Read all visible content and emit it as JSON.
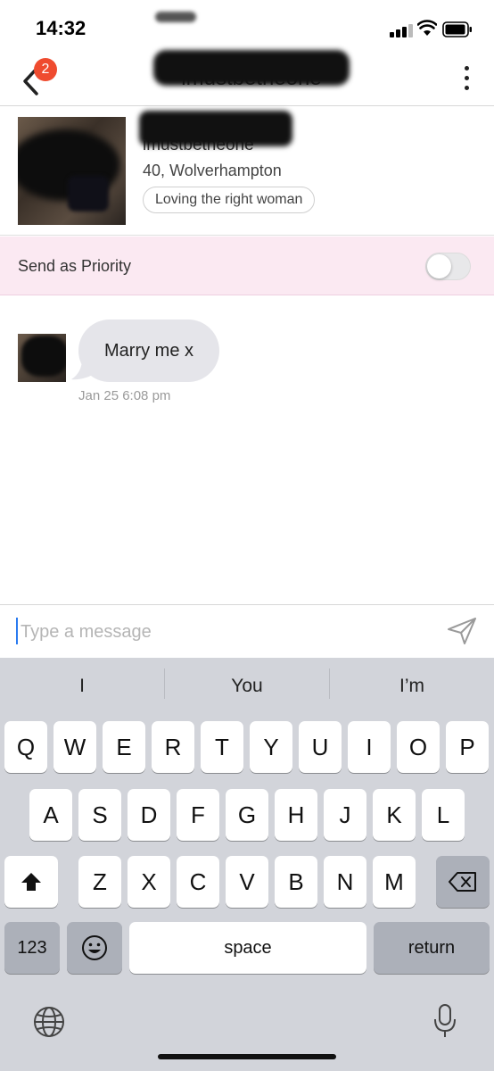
{
  "status": {
    "time": "14:32"
  },
  "header": {
    "back_badge": "2",
    "title": "imustbetheone",
    "back_icon": "chevron-left-icon",
    "more_icon": "vertical-dots-icon"
  },
  "profile": {
    "name": "imustbetheone",
    "location": "40, Wolverhampton",
    "tag": "Loving the right woman"
  },
  "priority": {
    "label": "Send as Priority",
    "enabled": false
  },
  "messages": [
    {
      "text": "Marry me x",
      "time": "Jan 25 6:08 pm"
    }
  ],
  "composer": {
    "placeholder": "Type a message",
    "send_icon": "send-icon"
  },
  "keyboard": {
    "suggestions": [
      "I",
      "You",
      "I’m"
    ],
    "row1": [
      "Q",
      "W",
      "E",
      "R",
      "T",
      "Y",
      "U",
      "I",
      "O",
      "P"
    ],
    "row2": [
      "A",
      "S",
      "D",
      "F",
      "G",
      "H",
      "J",
      "K",
      "L"
    ],
    "row3": [
      "Z",
      "X",
      "C",
      "V",
      "B",
      "N",
      "M"
    ],
    "numbers_label": "123",
    "space_label": "space",
    "return_label": "return",
    "shift_icon": "shift-icon",
    "delete_icon": "backspace-icon",
    "emoji_icon": "emoji-icon",
    "globe_icon": "globe-icon",
    "mic_icon": "microphone-icon"
  },
  "colors": {
    "badge": "#ef4b2f",
    "priority_bg": "#fbe9f2",
    "bubble": "#e5e5ea",
    "cursor": "#2a7bf0"
  }
}
